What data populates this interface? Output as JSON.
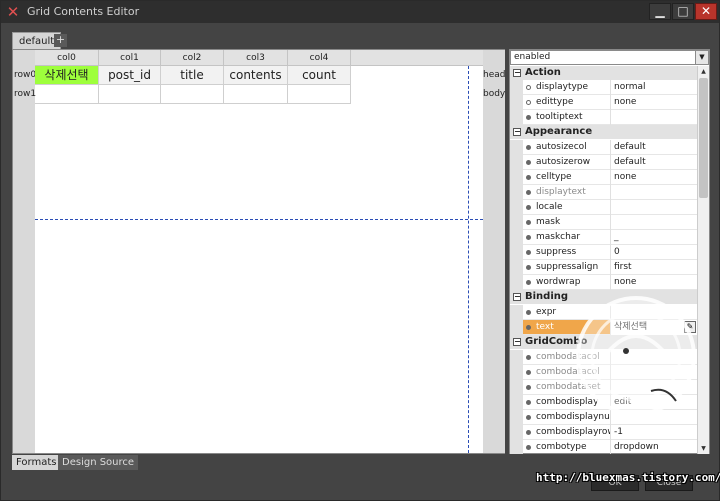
{
  "window": {
    "title": "Grid Contents Editor",
    "controls": {
      "minimize": "▁",
      "maximize": "□",
      "close": "✕"
    }
  },
  "tabs": {
    "active": "default",
    "add": "+"
  },
  "grid": {
    "columns": [
      "col0",
      "col1",
      "col2",
      "col3",
      "col4"
    ],
    "rows": [
      {
        "label": "row0",
        "band": "head",
        "cells": [
          "삭제선택",
          "post_id",
          "title",
          "contents",
          "count"
        ]
      },
      {
        "label": "row1",
        "band": "body",
        "cells": [
          "",
          "",
          "",
          "",
          ""
        ]
      }
    ],
    "selected_color": "#9eff3c",
    "guide_color": "#2a4db5"
  },
  "bottom_tabs": [
    "Formats",
    "Design Source"
  ],
  "properties": {
    "filter": "enabled",
    "categories": [
      {
        "name": "Action",
        "items": [
          {
            "name": "displaytype",
            "value": "normal",
            "dot": "hollow"
          },
          {
            "name": "edittype",
            "value": "none",
            "dot": "hollow"
          },
          {
            "name": "tooltiptext",
            "value": "",
            "dot": "solid"
          }
        ]
      },
      {
        "name": "Appearance",
        "items": [
          {
            "name": "autosizecol",
            "value": "default",
            "dot": "solid"
          },
          {
            "name": "autosizerow",
            "value": "default",
            "dot": "solid"
          },
          {
            "name": "celltype",
            "value": "none",
            "dot": "solid"
          },
          {
            "name": "displaytext",
            "value": "",
            "dot": "solid",
            "dim": true
          },
          {
            "name": "locale",
            "value": "",
            "dot": "solid"
          },
          {
            "name": "mask",
            "value": "",
            "dot": "solid"
          },
          {
            "name": "maskchar",
            "value": "_",
            "dot": "solid"
          },
          {
            "name": "suppress",
            "value": "0",
            "dot": "solid"
          },
          {
            "name": "suppressalign",
            "value": "first",
            "dot": "solid"
          },
          {
            "name": "wordwrap",
            "value": "none",
            "dot": "solid"
          }
        ]
      },
      {
        "name": "Binding",
        "items": [
          {
            "name": "expr",
            "value": "",
            "dot": "solid"
          },
          {
            "name": "text",
            "value": "삭제선택",
            "dot": "solid",
            "highlight": true
          }
        ]
      },
      {
        "name": "GridCombo",
        "items": [
          {
            "name": "combodatacol",
            "value": "",
            "dot": "solid",
            "dim": true
          },
          {
            "name": "combodatacol",
            "value": "",
            "dot": "solid",
            "dim": true
          },
          {
            "name": "combodataset",
            "value": "",
            "dot": "solid",
            "dim": true
          },
          {
            "name": "combodisplay",
            "value": "edit",
            "dot": "solid"
          },
          {
            "name": "combodisplaynul",
            "value": "",
            "dot": "solid"
          },
          {
            "name": "combodisplayrow",
            "value": "-1",
            "dot": "solid"
          },
          {
            "name": "combotype",
            "value": "dropdown",
            "dot": "solid"
          }
        ]
      }
    ],
    "highlight_color": "#f0a64a"
  },
  "footer": {
    "ok": "OK",
    "close": "Close"
  },
  "watermark_url": "http://bluexmas.tistory.com/"
}
